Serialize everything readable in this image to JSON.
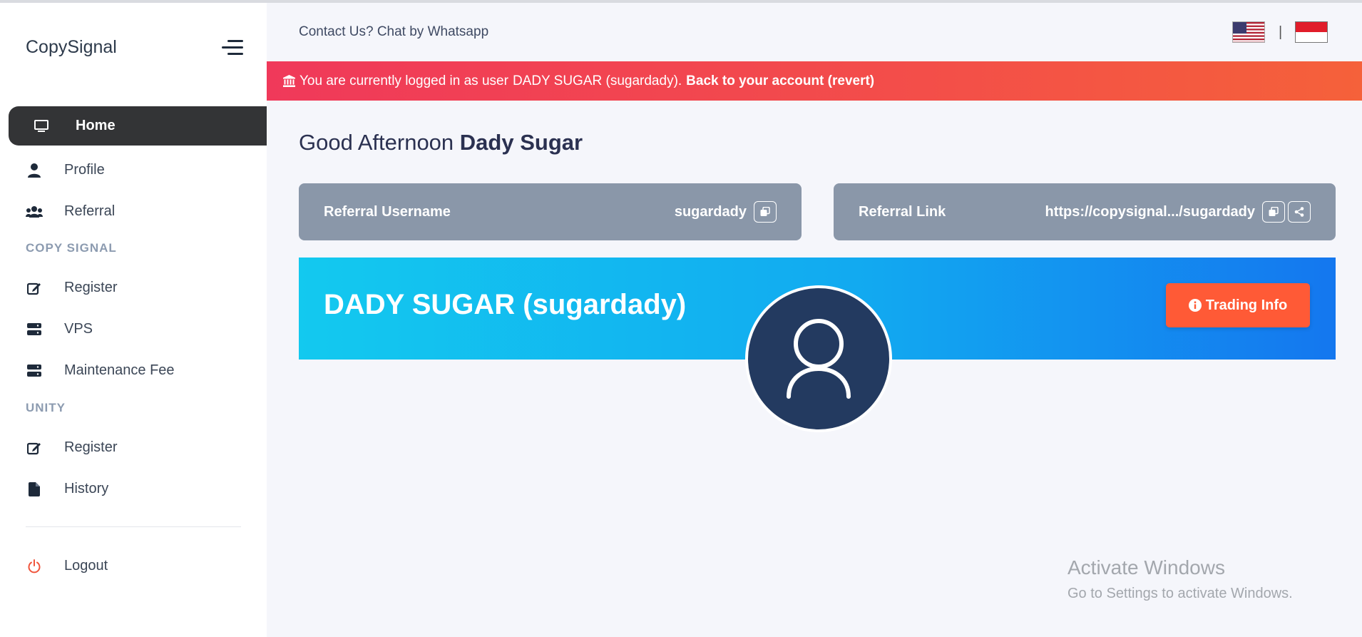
{
  "brand": "CopySignal",
  "sidebar": {
    "items": [
      {
        "label": "Home",
        "icon": "monitor-icon"
      },
      {
        "label": "Profile",
        "icon": "user-icon"
      },
      {
        "label": "Referral",
        "icon": "users-icon"
      },
      {
        "label": "Register",
        "icon": "edit-icon"
      },
      {
        "label": "VPS",
        "icon": "server-icon"
      },
      {
        "label": "Maintenance Fee",
        "icon": "server-icon"
      },
      {
        "label": "Register",
        "icon": "edit-icon"
      },
      {
        "label": "History",
        "icon": "file-icon"
      },
      {
        "label": "Logout",
        "icon": "power-icon"
      }
    ],
    "sections": [
      "COPY SIGNAL",
      "UNITY"
    ]
  },
  "header": {
    "contact": "Contact Us? Chat by Whatsapp",
    "separator": "|"
  },
  "impersonation": {
    "prefix": "You are currently logged in as user",
    "user": "DADY SUGAR (sugardady).",
    "revert": "Back to your account (revert)"
  },
  "greeting": {
    "prefix": "Good Afternoon",
    "name": "Dady Sugar"
  },
  "referral_username": {
    "label": "Referral Username",
    "value": "sugardady"
  },
  "referral_link": {
    "label": "Referral Link",
    "value": "https://copysignal.../sugardady"
  },
  "profile_banner": {
    "name": "DADY SUGAR (sugardady)",
    "button": "Trading Info"
  },
  "watermark": {
    "title": "Activate Windows",
    "subtitle": "Go to Settings to activate Windows."
  },
  "colors": {
    "active_nav": "#333436",
    "alert_start": "#f0395a",
    "alert_end": "#f5613a",
    "card_bg": "#8a97a9",
    "banner_start": "#13c9ef",
    "banner_end": "#1477ef",
    "trading_button": "#ff5a36",
    "avatar_bg": "#233a60"
  }
}
